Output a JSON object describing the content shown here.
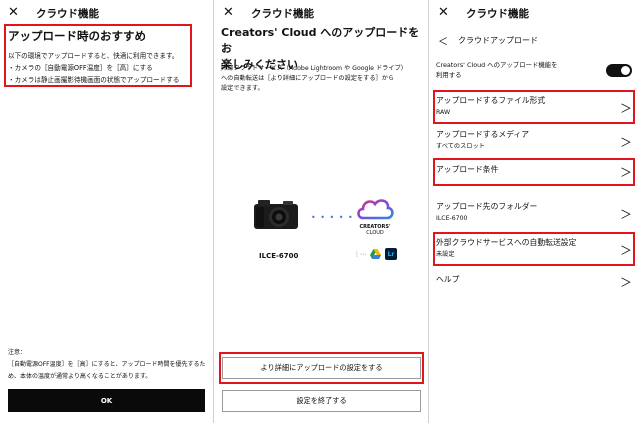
{
  "panel1": {
    "header": {
      "close": "✕",
      "title": "クラウド機能"
    },
    "heading": "アップロード時のおすすめ",
    "body": [
      "以下の環境でアップロードすると、快適に利用できます。",
      "・カメラの［自動電源OFF温度］を［高］にする",
      "・カメラは静止画撮影待機画面の状態でアップロードする"
    ],
    "note_label": "注意：",
    "note": [
      "［自動電源OFF温度］を［高］にすると、アップロード時間を優先するた",
      "め、本体の温度が通常より高くなることがあります。"
    ],
    "ok_button": "OK"
  },
  "panel2": {
    "header": {
      "close": "✕",
      "title": "クラウド機能"
    },
    "heading": [
      "Creators' Cloud へのアップロードをお",
      "楽しみください"
    ],
    "body": [
      "外部クラウドサービス（Adobe Lightroom や Google ドライブ）",
      "への自動転送は［より詳細にアップロードの設定をする］から",
      "設定できます。"
    ],
    "camera_model": "ILCE-6700",
    "dots": "• • • • • •",
    "cloud_brand": [
      "CREATORS'",
      "CLOUD"
    ],
    "services": {
      "more": "⋮⋯",
      "lightroom": "Lr"
    },
    "detail_button": "より詳細にアップロードの設定をする",
    "finish_button": "設定を終了する"
  },
  "panel3": {
    "header": {
      "close": "✕",
      "title": "クラウド機能"
    },
    "subheader": {
      "back": "＜",
      "title": "クラウドアップロード"
    },
    "cc_toggle_desc": [
      "Creators' Cloud へのアップロード機能を",
      "利用する"
    ],
    "toggle_on": true,
    "rows": [
      {
        "label": "アップロードするファイル形式",
        "value": "RAW"
      },
      {
        "label": "アップロードするメディア",
        "value": "すべてのスロット"
      },
      {
        "label": "アップロード条件",
        "value": ""
      },
      {
        "label": "アップロード先のフォルダー",
        "value": "ILCE-6700"
      },
      {
        "label": "外部クラウドサービスへの自動転送設定",
        "value": "未設定"
      },
      {
        "label": "ヘルプ",
        "value": ""
      }
    ],
    "chevron": "＞"
  },
  "colors": {
    "highlight": "#e3141c",
    "cloud_gradient": [
      "#e0308a",
      "#7a4ad8",
      "#2d8ce0"
    ],
    "dots": "#4a72d8"
  }
}
